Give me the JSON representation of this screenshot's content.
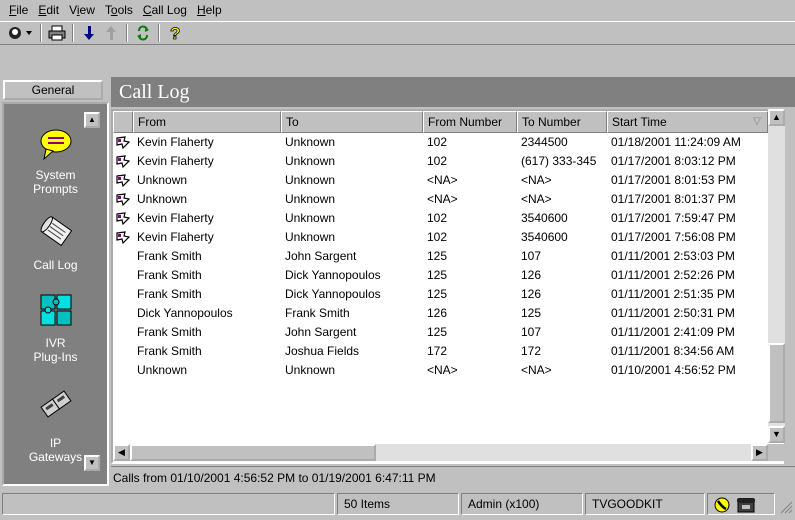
{
  "menu": {
    "items": [
      {
        "key": "F",
        "rest": "ile"
      },
      {
        "key": "E",
        "rest": "dit"
      },
      {
        "pre": "V",
        "key": "i",
        "rest": "ew"
      },
      {
        "pre": "T",
        "key": "o",
        "rest": "ols"
      },
      {
        "key": "C",
        "rest": "all Log"
      },
      {
        "key": "H",
        "rest": "elp"
      }
    ]
  },
  "sidebar": {
    "tab_label": "General",
    "items": [
      {
        "label": "System Prompts",
        "icon": "speech-bubble-icon"
      },
      {
        "label": "Call Log",
        "icon": "scroll-icon"
      },
      {
        "label": "IVR Plug-Ins",
        "icon": "puzzle-icon"
      },
      {
        "label": "IP Gateways",
        "icon": "gateway-icon"
      }
    ]
  },
  "header": {
    "title": "Call Log"
  },
  "table": {
    "columns": [
      "From",
      "To",
      "From Number",
      "To Number",
      "Start Time"
    ],
    "rows": [
      {
        "icon": true,
        "from": "Kevin Flaherty",
        "to": "Unknown",
        "from_number": "102",
        "to_number": "2344500",
        "start": "01/18/2001 11:24:09 AM"
      },
      {
        "icon": true,
        "from": "Kevin Flaherty",
        "to": "Unknown",
        "from_number": "102",
        "to_number": "(617) 333-345",
        "start": "01/17/2001 8:03:12 PM"
      },
      {
        "icon": true,
        "from": "Unknown",
        "to": "Unknown",
        "from_number": "<NA>",
        "to_number": "<NA>",
        "start": "01/17/2001 8:01:53 PM"
      },
      {
        "icon": true,
        "from": "Unknown",
        "to": "Unknown",
        "from_number": "<NA>",
        "to_number": "<NA>",
        "start": "01/17/2001 8:01:37 PM"
      },
      {
        "icon": true,
        "from": "Kevin Flaherty",
        "to": "Unknown",
        "from_number": "102",
        "to_number": "3540600",
        "start": "01/17/2001 7:59:47 PM"
      },
      {
        "icon": true,
        "from": "Kevin Flaherty",
        "to": "Unknown",
        "from_number": "102",
        "to_number": "3540600",
        "start": "01/17/2001 7:56:08 PM"
      },
      {
        "icon": false,
        "from": "Frank Smith",
        "to": "John Sargent",
        "from_number": "125",
        "to_number": "107",
        "start": "01/11/2001 2:53:03 PM"
      },
      {
        "icon": false,
        "from": "Frank Smith",
        "to": "Dick Yannopoulos",
        "from_number": "125",
        "to_number": "126",
        "start": "01/11/2001 2:52:26 PM"
      },
      {
        "icon": false,
        "from": "Frank Smith",
        "to": "Dick Yannopoulos",
        "from_number": "125",
        "to_number": "126",
        "start": "01/11/2001 2:51:35 PM"
      },
      {
        "icon": false,
        "from": "Dick Yannopoulos",
        "to": "Frank Smith",
        "from_number": "126",
        "to_number": "125",
        "start": "01/11/2001 2:50:31 PM"
      },
      {
        "icon": false,
        "from": "Frank Smith",
        "to": "John Sargent",
        "from_number": "125",
        "to_number": "107",
        "start": "01/11/2001 2:41:09 PM"
      },
      {
        "icon": false,
        "from": "Frank Smith",
        "to": "Joshua Fields",
        "from_number": "172",
        "to_number": "172",
        "start": "01/11/2001 8:34:56 AM"
      },
      {
        "icon": false,
        "from": "Unknown",
        "to": "Unknown",
        "from_number": "<NA>",
        "to_number": "<NA>",
        "start": "01/10/2001 4:56:52 PM"
      }
    ]
  },
  "range_text": "Calls from 01/10/2001 4:56:52 PM to 01/19/2001 6:47:11 PM",
  "statusbar": {
    "items_count": "50 Items",
    "user": "Admin (x100)",
    "server": "TVGOODKIT"
  }
}
